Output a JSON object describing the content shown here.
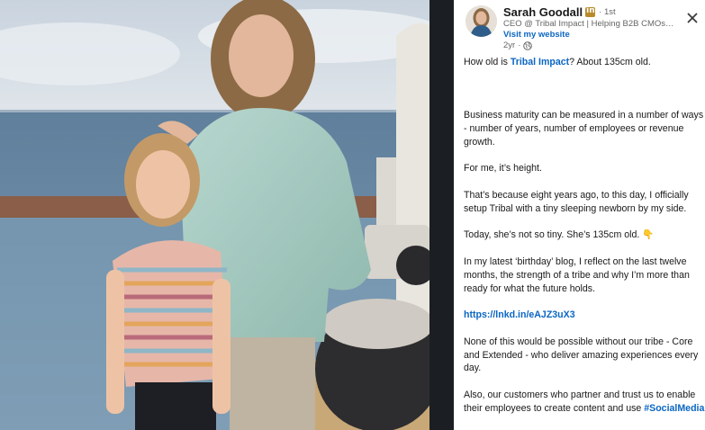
{
  "author": {
    "name": "Sarah Goodall",
    "degree": "· 1st",
    "headline": "CEO @ Tribal Impact | Helping B2B CMOs ...",
    "website_label": "Visit my website",
    "time": "2yr",
    "badge_icon": "linkedin-premium-icon",
    "visibility_icon": "globe-icon"
  },
  "close_icon": "close-icon",
  "post": {
    "p1_before": "How old is ",
    "p1_company": "Tribal Impact",
    "p1_after": "? About 135cm old.",
    "p2": "Business maturity can be measured in a number of ways - number of years, number of employees or revenue growth.",
    "p3": "For me, it’s height.",
    "p4": "That’s because eight years ago, to this day, I officially setup Tribal with a tiny sleeping newborn by my side.",
    "p5": "Today, she’s not so tiny. She’s 135cm old. 👇",
    "p6": "In my latest ‘birthday’ blog, I reflect on the last twelve months, the strength of a tribe and why I’m more than ready for what the future holds.",
    "link": "https://lnkd.in/eAJZ3uX3",
    "p7": "None of this would be possible without our tribe - Core and Extended - who deliver amazing experiences every day.",
    "p8": "Also, our customers who partner and trust us to enable their employees to create content and use",
    "hashtag": "#SocialMedia",
    "p8_end": "."
  },
  "colors": {
    "accent": "#0a66c2",
    "divider": "#1b1f23",
    "text": "#191919",
    "muted": "#666666"
  }
}
